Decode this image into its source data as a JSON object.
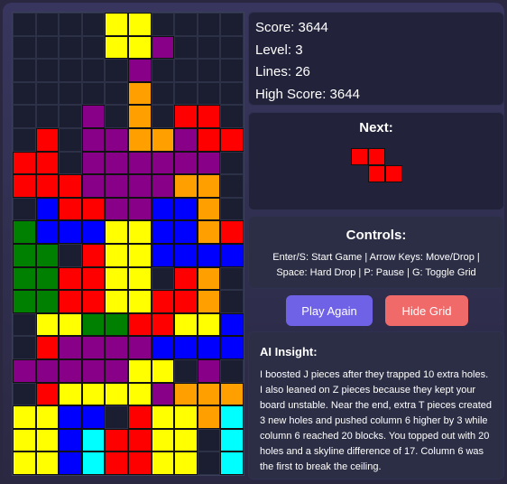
{
  "colors": {
    "empty": "#1b1e30",
    "Y": "#ffff00",
    "P": "#880088",
    "O": "#ff9f00",
    "R": "#ff0000",
    "B": "#0000ff",
    "G": "#008000",
    "C": "#00ffff"
  },
  "board": {
    "rows": [
      "....YY....",
      "....YYP...",
      ".....P....",
      ".....O....",
      "...P.O.RR.",
      ".R.PPOOPRR",
      "RR.PPPPPP.",
      "RRRPPPPOO.",
      ".BRRPPBBO.",
      "GBBBYYBBOR",
      "GG.RYYBBBB",
      "GGRRYY.RO.",
      "GGRRYYRRO.",
      ".YYGGRRYYB",
      ".RPPPPBBBB",
      "PPPPPYY.P.",
      ".RYYYYPOOO",
      "YYBB.RYYOC",
      "YYBCRRYY.C",
      "YYBCRRYY.C"
    ]
  },
  "stats": {
    "score": "Score: 3644",
    "level": "Level: 3",
    "lines": "Lines: 26",
    "high_score": "High Score: 3644"
  },
  "next": {
    "title": "Next:",
    "piece": "Z",
    "rows": [
      "RR.",
      ".RR"
    ]
  },
  "controls": {
    "title": "Controls:",
    "text": "Enter/S: Start Game | Arrow Keys: Move/Drop | Space: Hard Drop | P: Pause | G: Toggle Grid"
  },
  "buttons": {
    "play_again": "Play Again",
    "hide_grid": "Hide Grid"
  },
  "insight": {
    "title": "AI Insight:",
    "text": "I boosted J pieces after they trapped 10 extra holes. I also leaned on Z pieces because they kept your board unstable. Near the end, extra T pieces created 3 new holes and pushed column 6 higher by 3 while column 6 reached 20 blocks. You topped out with 20 holes and a skyline difference of 17. Column 6 was the first to break the ceiling."
  }
}
